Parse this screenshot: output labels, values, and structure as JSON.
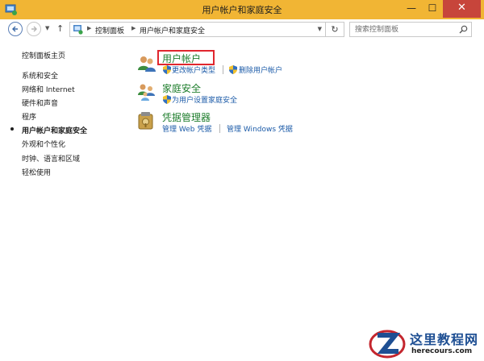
{
  "window": {
    "title": "用户帐户和家庭安全",
    "titlebar_color": "#f1b534",
    "close_color": "#c7453b",
    "buttons": {
      "minimize": "—",
      "maximize": "☐",
      "close": "✕"
    }
  },
  "nav": {
    "back_icon": "back-arrow-icon",
    "forward_icon": "forward-arrow-icon",
    "up_icon": "up-arrow-icon",
    "breadcrumb": [
      "控制面板",
      "用户帐户和家庭安全"
    ],
    "refresh_icon": "refresh-icon",
    "search_placeholder": "搜索控制面板"
  },
  "sidebar": {
    "items": [
      {
        "label": "控制面板主页",
        "current": false
      },
      {
        "label": "系统和安全",
        "current": false
      },
      {
        "label": "网络和 Internet",
        "current": false
      },
      {
        "label": "硬件和声音",
        "current": false
      },
      {
        "label": "程序",
        "current": false
      },
      {
        "label": "用户帐户和家庭安全",
        "current": true
      },
      {
        "label": "外观和个性化",
        "current": false
      },
      {
        "label": "时钟、语言和区域",
        "current": false
      },
      {
        "label": "轻松使用",
        "current": false
      }
    ]
  },
  "categories": [
    {
      "title": "用户帐户",
      "icon": "user-accounts-icon",
      "highlighted": true,
      "links": [
        {
          "label": "更改帐户类型",
          "shield": true
        },
        {
          "label": "删除用户帐户",
          "shield": true
        }
      ]
    },
    {
      "title": "家庭安全",
      "icon": "family-safety-icon",
      "highlighted": false,
      "links": [
        {
          "label": "为用户设置家庭安全",
          "shield": true
        }
      ]
    },
    {
      "title": "凭据管理器",
      "icon": "credential-manager-icon",
      "highlighted": false,
      "links": [
        {
          "label": "管理 Web 凭据",
          "shield": false
        },
        {
          "label": "管理 Windows 凭据",
          "shield": false
        }
      ]
    }
  ],
  "colors": {
    "category_title": "#1e7d2c",
    "link": "#1c5ba8",
    "highlight_box": "#e0262e"
  },
  "watermark": {
    "text_cn": "这里教程网",
    "text_en": "herecours.com"
  }
}
